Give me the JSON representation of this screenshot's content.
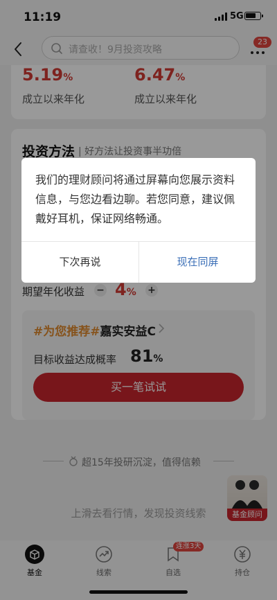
{
  "status_bar": {
    "time": "11:19",
    "network": "5G"
  },
  "nav": {
    "search_placeholder": "请查收！9月投资攻略",
    "more_badge": "23"
  },
  "yields": [
    {
      "value": "5.19",
      "unit": "%",
      "label": "成立以来年化"
    },
    {
      "value": "6.47",
      "unit": "%",
      "label": "成立以来年化"
    }
  ],
  "method": {
    "title": "投资方法",
    "subtitle": "| 好方法让投资事半功倍",
    "expect_label": "期望年化收益",
    "minus": "−",
    "plus": "+",
    "expect_value": "4",
    "expect_unit": "%"
  },
  "recommend": {
    "tag": "#为您推荐#",
    "fund_name": "嘉实安益C",
    "prob_label": "目标收益达成概率",
    "prob_value": "81",
    "prob_unit": "%",
    "buy_label": "买一笔试试"
  },
  "trust_text": "超15年投研沉淀，值得信赖",
  "swipe_hint": "上滑去看行情，发现投资线索",
  "advisor_label": "基金顾问",
  "dialog": {
    "message": "我们的理财顾问将通过屏幕向您展示资料信息，与您边看边聊。若您同意，建议佩戴好耳机，保证网络畅通。",
    "cancel": "下次再说",
    "confirm": "现在同屏"
  },
  "tabs": [
    {
      "label": "基金",
      "icon": "fund-box-icon",
      "active": true
    },
    {
      "label": "线索",
      "icon": "trend-icon",
      "active": false
    },
    {
      "label": "自选",
      "icon": "bookmark-icon",
      "active": false,
      "badge": "连涨3天"
    },
    {
      "label": "持仓",
      "icon": "yen-icon",
      "active": false
    }
  ],
  "colors": {
    "accent_red": "#c9262d",
    "value_red": "#d23b35",
    "link_blue": "#3b6fb7",
    "tag_orange": "#e08a2f"
  }
}
